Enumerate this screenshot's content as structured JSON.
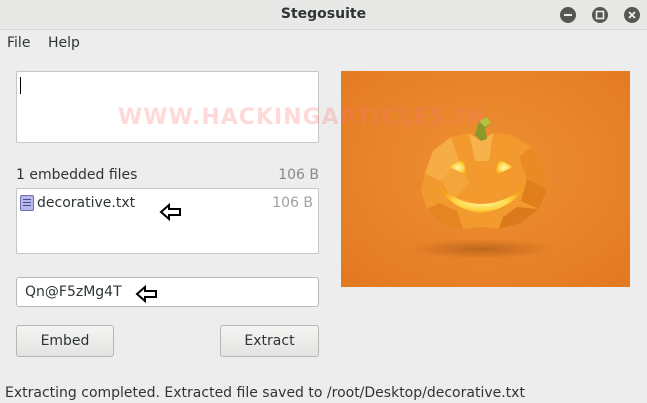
{
  "window": {
    "title": "Stegosuite"
  },
  "menu": {
    "items": [
      "File",
      "Help"
    ]
  },
  "message": {
    "value": ""
  },
  "embedded": {
    "count_label": "1 embedded files",
    "total_size": "106 B",
    "files": [
      {
        "name": "decorative.txt",
        "size": "106 B"
      }
    ]
  },
  "password": {
    "value": "Qn@F5zMg4T"
  },
  "buttons": {
    "embed": "Embed",
    "extract": "Extract"
  },
  "image": {
    "watermark": "WWW.HACKINGARTICLES.IN"
  },
  "status": {
    "text": "Extracting completed. Extracted file saved to /root/Desktop/decorative.txt"
  },
  "colors": {
    "image_background": "#e8822a",
    "pumpkin": "#f39a2a"
  },
  "icons": [
    "minimize-icon",
    "maximize-icon",
    "close-icon",
    "text-file-icon",
    "arrow-left-icon"
  ]
}
